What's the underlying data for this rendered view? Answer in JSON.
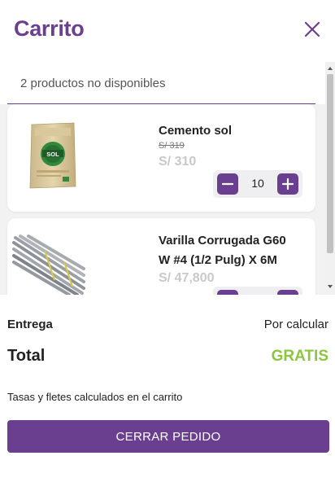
{
  "header": {
    "title": "Carrito",
    "close_icon": "close-icon"
  },
  "notice": {
    "unavailable_text": "2 productos no disponibles"
  },
  "cart_items": [
    {
      "name": "Cemento sol",
      "old_price": "S/ 319",
      "price": "S/ 310",
      "quantity": "10",
      "image": "cement-bag-icon"
    },
    {
      "name_line1": "Varilla Corrugada G60",
      "name_line2": "W #4 (1/2 Pulg) X 6M",
      "price": "S/ 47,800",
      "image": "rebar-bundle-icon"
    }
  ],
  "summary": {
    "entrega_label": "Entrega",
    "entrega_value": "Por calcular",
    "total_label": "Total",
    "total_value": "GRATIS",
    "tasas_note": "Tasas y fletes calculados en el carrito",
    "cta_label": "CERRAR PEDIDO"
  },
  "colors": {
    "brand_purple": "#6a3f8f",
    "accent_green": "#8cc63f",
    "price_gray": "#c9c9c9"
  }
}
